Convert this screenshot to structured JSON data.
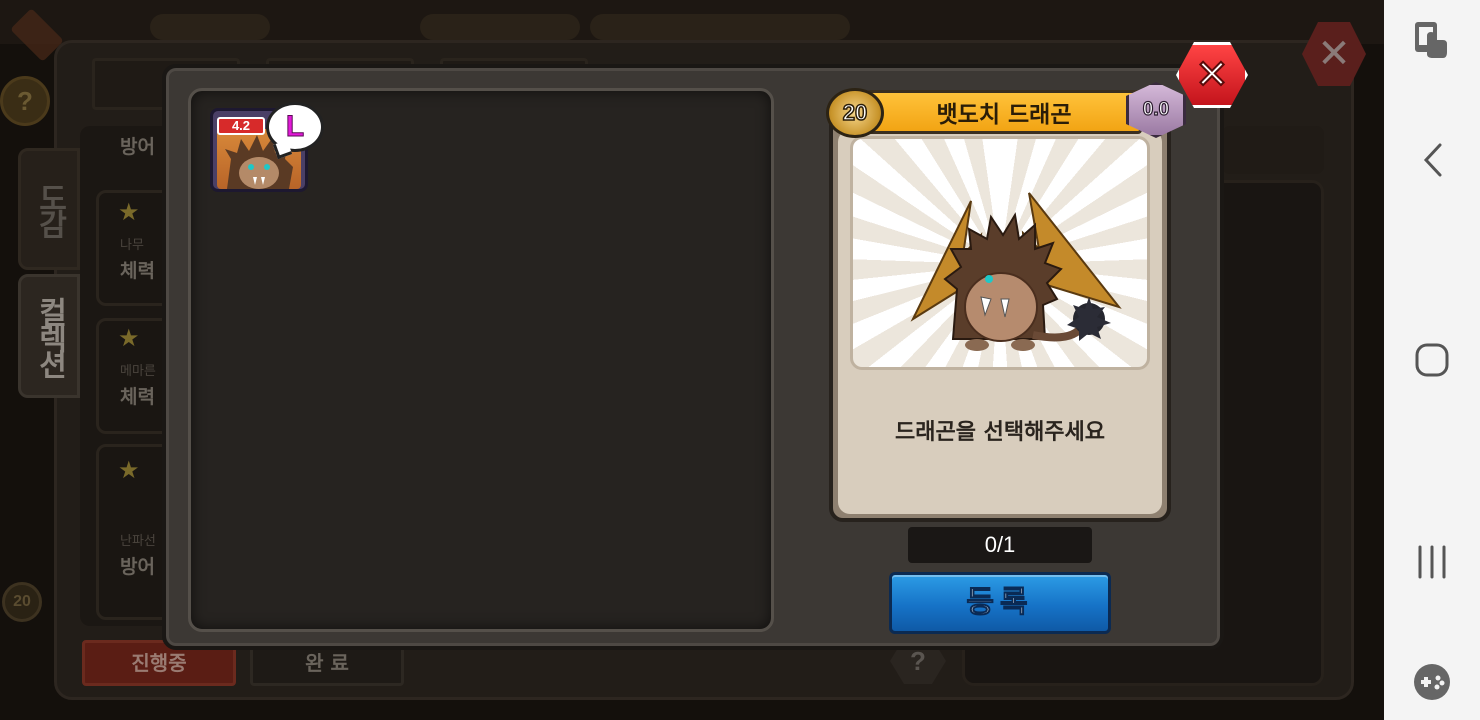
{
  "background": {
    "side_tabs": [
      "도감",
      "컬렉션"
    ],
    "list_items": [
      {
        "category": "나무",
        "stat": "체력"
      },
      {
        "category": "메마른",
        "stat": "체력"
      },
      {
        "category": "난파선",
        "stat": "방어"
      }
    ],
    "partial_top_item": "방어",
    "bottom_tabs": {
      "in_progress": "진행중",
      "complete": "완 료"
    },
    "level_badge": "20",
    "help_icon": "?"
  },
  "inventory": {
    "slots": [
      {
        "rating": "4.2",
        "grade": "L"
      }
    ]
  },
  "card": {
    "level": "20",
    "name": "뱃도치 드래곤",
    "score": "0.0",
    "description": "드래곤을 선택해주세요"
  },
  "counter": "0/1",
  "register_button": "등록",
  "close_button": "✕",
  "colors": {
    "register_blue": "#1673c7",
    "title_gold": "#f2a414",
    "close_red": "#c4141c",
    "grade_magenta": "#e21ad8"
  },
  "nav_bar": {
    "icons": [
      "screen-touch-icon",
      "back-icon",
      "home-icon",
      "recents-icon",
      "game-tools-icon"
    ]
  }
}
